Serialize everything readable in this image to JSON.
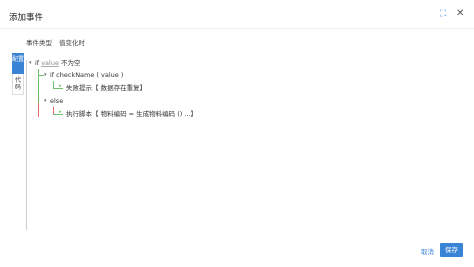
{
  "dialog": {
    "title": "添加事件",
    "expand_icon": "⛶",
    "close_icon": "✕"
  },
  "event": {
    "type_label": "事件类型",
    "type_value": "值变化时"
  },
  "side_tabs": [
    {
      "label": "配置"
    },
    {
      "label": "代码"
    }
  ],
  "tree": {
    "if_kw": "if",
    "if_var": "value",
    "if_cond": "不为空",
    "nested_if_text": "if checkName ( value )",
    "fail_text": "失败提示【 数据存在重复】",
    "else_text": "else",
    "exec_text": "执行脚本【 物料编码 = 生成物料编码 () ...】"
  },
  "footer": {
    "cancel_label": "取消",
    "save_label": "保存"
  },
  "colors": {
    "accent": "#3a84d6",
    "true_branch": "#6cc26c",
    "false_branch": "#e36a6a"
  }
}
